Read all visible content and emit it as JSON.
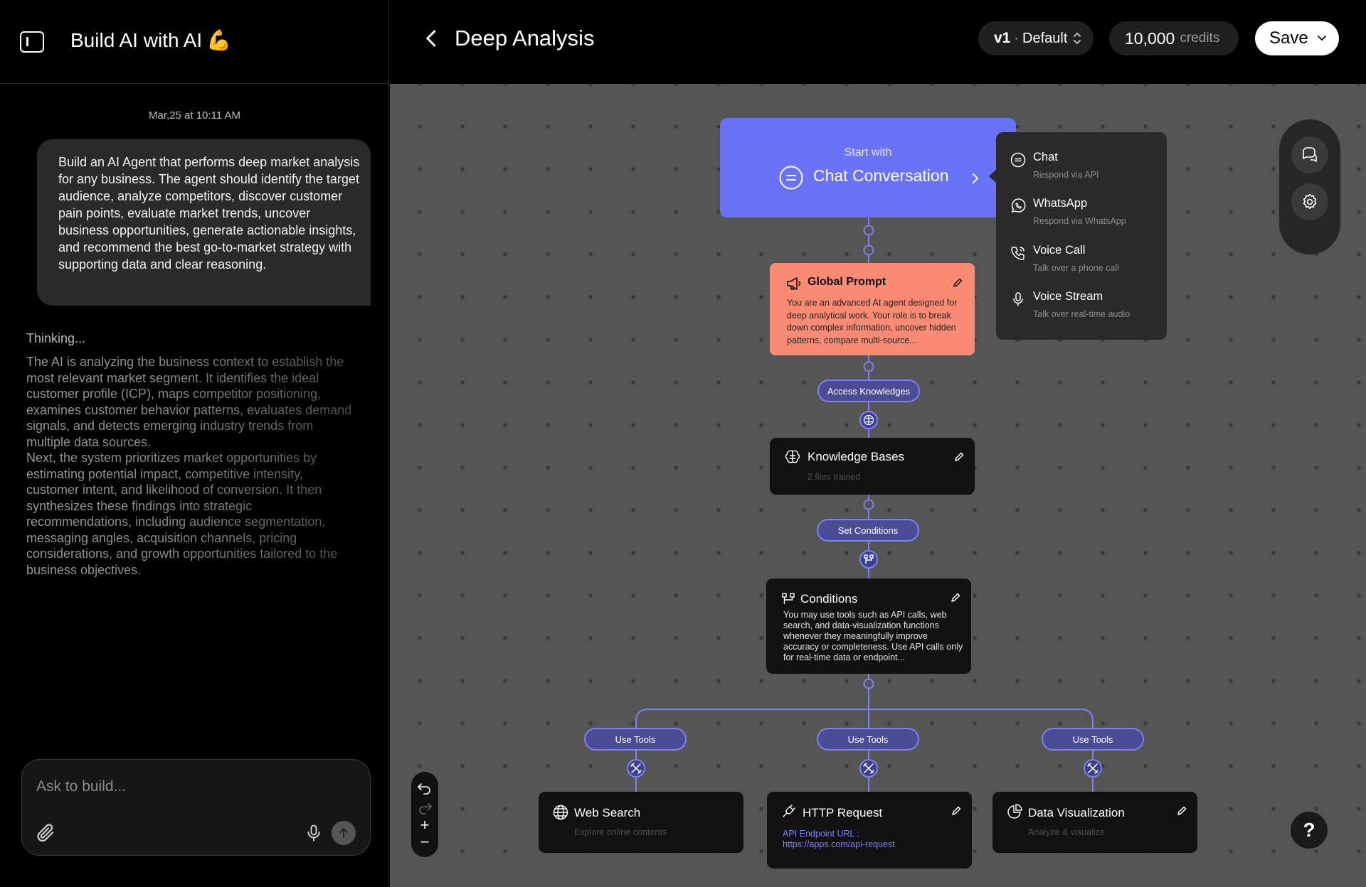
{
  "left_panel": {
    "app_title": "Build AI with AI",
    "app_title_emoji": "💪",
    "timestamp": "Mar,25 at 10:11 AM",
    "user_message": "Build an AI Agent that performs deep market analysis for any business. The agent should identify the target audience, analyze competitors, discover customer pain points, evaluate market trends, uncover business opportunities, generate actionable insights, and recommend the best go-to-market strategy with supporting data and clear reasoning.",
    "thinking_label": "Thinking...",
    "thinking_paragraphs": [
      "The AI is analyzing the business context to establish the most relevant market segment. It identifies the ideal customer profile (ICP), maps competitor positioning, examines customer behavior patterns, evaluates demand signals, and detects emerging industry trends from multiple data sources.",
      "Next, the system prioritizes market opportunities by estimating potential impact, competitive intensity, customer intent, and likelihood of conversion. It then synthesizes these findings into strategic recommendations, including audience segmentation, messaging angles, acquisition channels, pricing considerations, and growth opportunities tailored to the business objectives."
    ],
    "composer_placeholder": "Ask to build..."
  },
  "topbar": {
    "title": "Deep Analysis",
    "version": "v1",
    "version_sep": "·",
    "version_name": "Default",
    "credits_value": "10,000",
    "credits_label": "credits",
    "save_label": "Save"
  },
  "flow": {
    "start": {
      "label": "Start with",
      "title": "Chat Conversation"
    },
    "channels": [
      {
        "name": "Chat",
        "sub": "Respond via API",
        "icon": "chat-icon"
      },
      {
        "name": "WhatsApp",
        "sub": "Respond via WhatsApp",
        "icon": "whatsapp-icon"
      },
      {
        "name": "Voice Call",
        "sub": "Talk over a phone call",
        "icon": "phone-icon"
      },
      {
        "name": "Voice Stream",
        "sub": "Talk over real-time audio",
        "icon": "microphone-icon"
      }
    ],
    "global_prompt": {
      "title": "Global Prompt",
      "desc": "You are an advanced AI agent designed for deep analytical work. Your role is to break down complex information, uncover hidden patterns, compare multi-source..."
    },
    "pill_access": "Access Knowledges",
    "knowledge": {
      "title": "Knowledge Bases",
      "sub": "2 files trained"
    },
    "pill_conditions": "Set Conditions",
    "conditions": {
      "title": "Conditions",
      "desc": "You may use tools such as API calls, web search, and data-visualization functions whenever they meaningfully improve accuracy or completeness. Use API calls only for real-time data or endpoint..."
    },
    "pill_tools": [
      "Use Tools",
      "Use Tools",
      "Use Tools"
    ],
    "web_search": {
      "title": "Web Search",
      "sub": "Explore online contents"
    },
    "http_request": {
      "title": "HTTP Request",
      "url_label": "API Endpoint URL :",
      "url": "https://apps.com/api-request"
    },
    "data_viz": {
      "title": "Data Visualization",
      "sub": "Analyze & visualize"
    }
  },
  "canvas_controls": {
    "help_label": "?",
    "zoom_in": "+",
    "zoom_out": "−"
  },
  "colors": {
    "accent": "#6b73f5",
    "global_prompt": "#f98b75",
    "pill_bg": "#4a4d96",
    "pill_border": "#7d82f0",
    "canvas": "#555555"
  }
}
